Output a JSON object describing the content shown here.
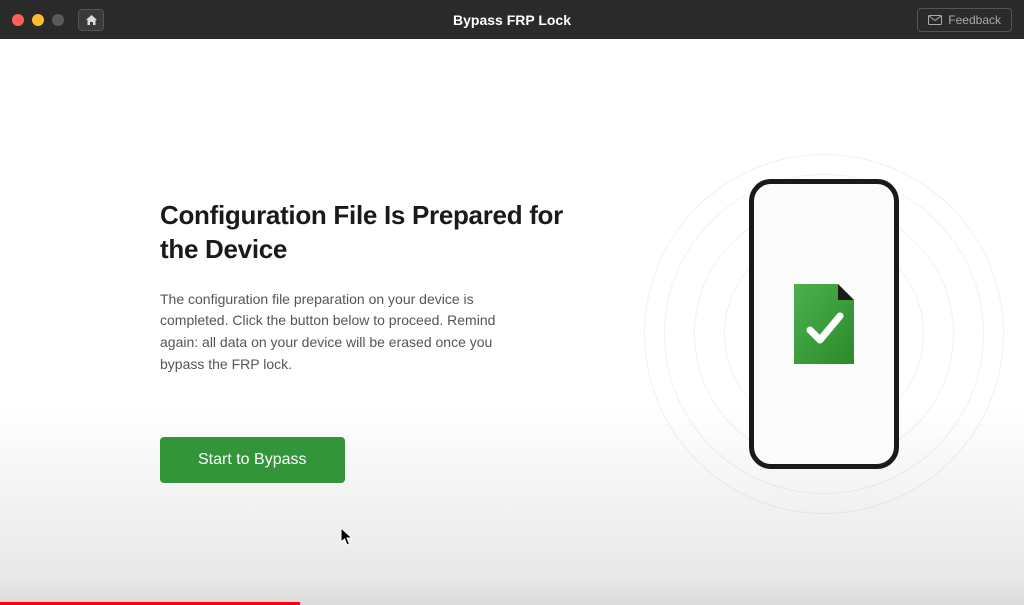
{
  "titlebar": {
    "title": "Bypass FRP Lock",
    "feedback_label": "Feedback"
  },
  "main": {
    "heading": "Configuration File Is Prepared for the Device",
    "description": "The configuration file preparation on your device is completed. Click the button below to proceed. Remind again: all data on your device will be erased once you bypass the FRP lock.",
    "cta_label": "Start to Bypass"
  },
  "colors": {
    "accent": "#33953a",
    "file_green_light": "#4db04d",
    "file_green_dark": "#2a8a2a"
  }
}
